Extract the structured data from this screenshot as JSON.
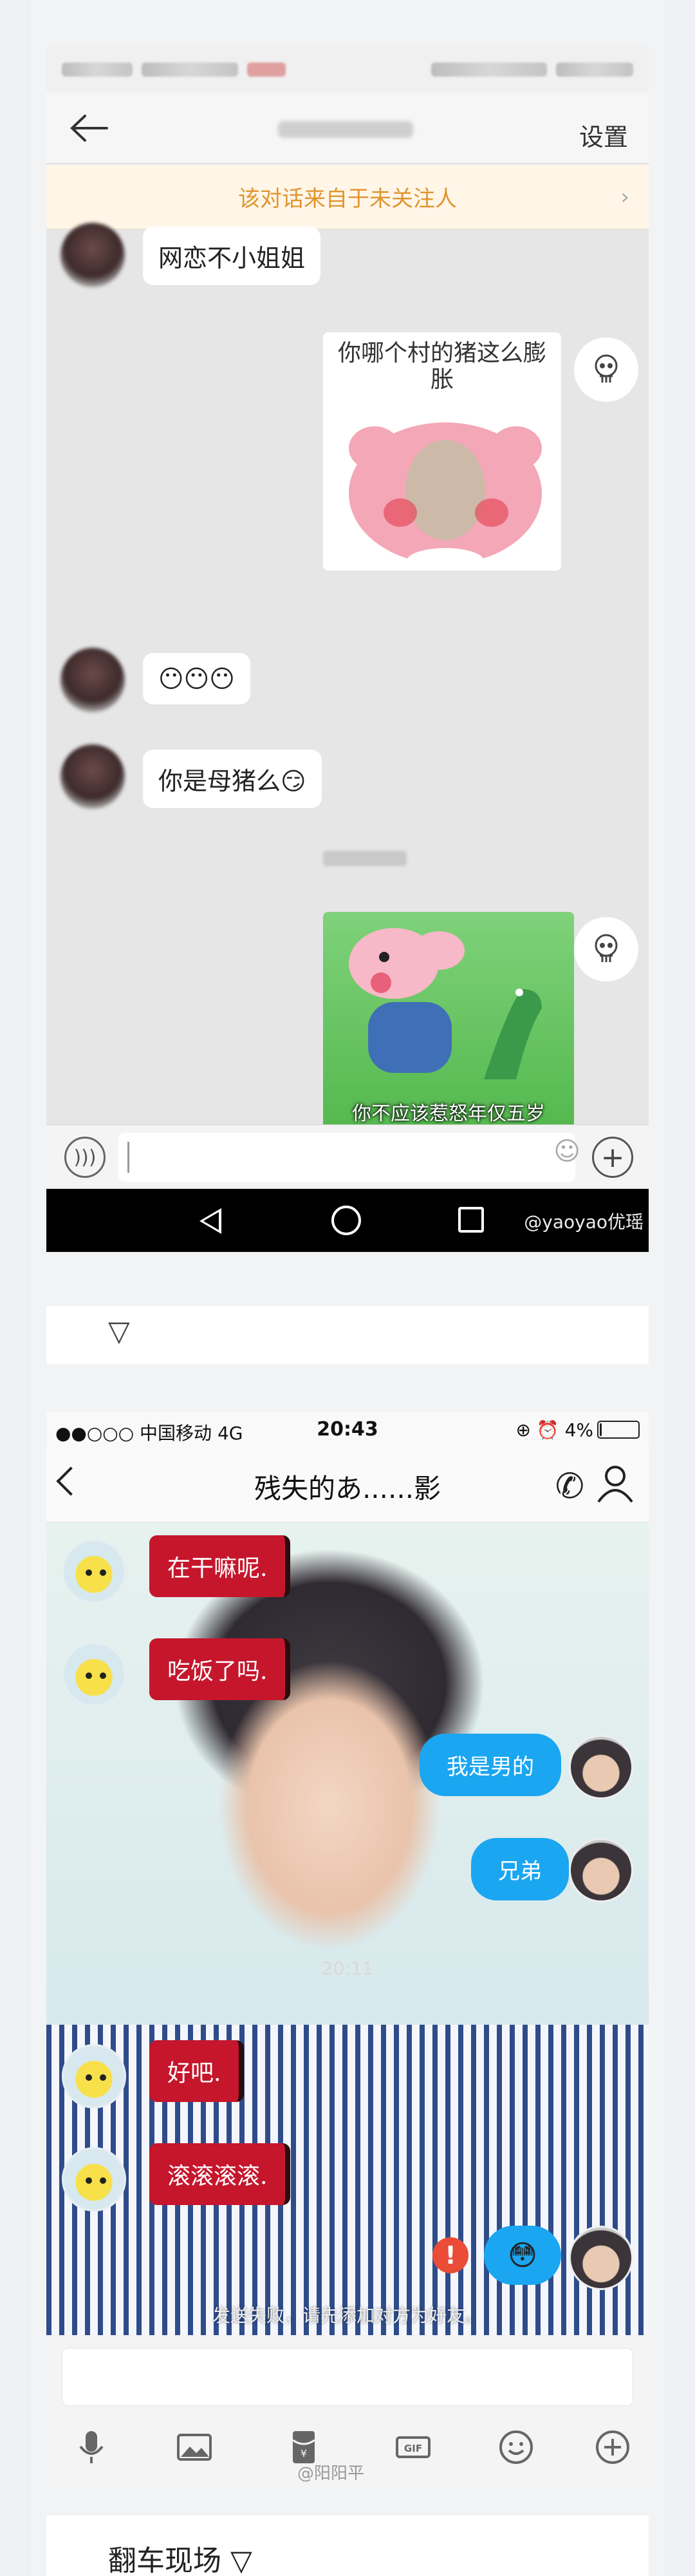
{
  "screenshot1": {
    "header": {
      "settings_label": "设置"
    },
    "notice": {
      "text": "该对话来自于未关注人",
      "chevron": "›"
    },
    "messages": [
      {
        "side": "left",
        "text": "网恋不小姐姐"
      },
      {
        "side": "right",
        "type": "sticker",
        "caption": "你哪个村的猪这么膨胀"
      },
      {
        "side": "left",
        "text": "😶😶😶"
      },
      {
        "side": "left",
        "text": "你是母猪么😏"
      },
      {
        "side": "right",
        "type": "sticker",
        "caption": "你不应该惹怒年仅五岁\n且手持大型生化武器的我"
      }
    ],
    "input": {
      "voice_icon": "voice-icon",
      "emoji_icon": "emoji-icon",
      "plus_icon": "plus-icon"
    },
    "watermark": "@yaoyao优瑶"
  },
  "caption1": {
    "icon": "▽"
  },
  "screenshot2": {
    "status": {
      "carrier": "●●○○○ 中国移动  4G",
      "time": "20:43",
      "battery": "⊕ ⏰ 4%",
      "battery_level": 0.04
    },
    "header": {
      "title": "残失的あ......影"
    },
    "messages": [
      {
        "side": "left",
        "text": "在干嘛呢."
      },
      {
        "side": "left",
        "text": "吃饭了吗."
      },
      {
        "side": "right",
        "text": "我是男的"
      },
      {
        "side": "right",
        "text": "兄弟"
      },
      {
        "side": "left",
        "text": "好吧."
      },
      {
        "side": "left",
        "text": "滚滚滚滚."
      },
      {
        "side": "right",
        "text": "😳",
        "failed": true
      }
    ],
    "timestamp": "20:11",
    "error_mark": "!",
    "fail_notice": "发送失败，请先添加对方为好友。",
    "watermark": "@阳阳平"
  },
  "caption2": {
    "text": "翻车现场 ▽"
  },
  "colors": {
    "notice_text": "#e0952f",
    "red_bubble": "#c5162c",
    "blue_bubble": "#1aa6f0",
    "error": "#ea4c38"
  }
}
